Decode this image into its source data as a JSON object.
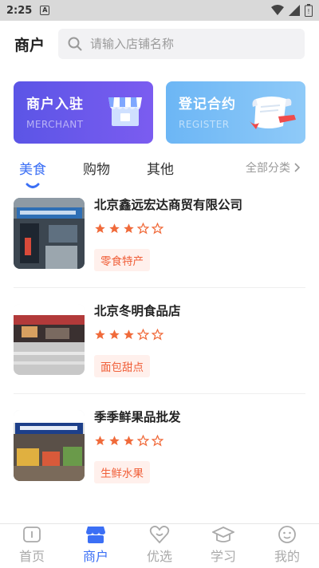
{
  "status_bar": {
    "time": "2:25",
    "notification_badge": "A"
  },
  "header": {
    "title": "商户",
    "search_placeholder": "请输入店铺名称"
  },
  "cards": [
    {
      "title": "商户入驻",
      "subtitle": "MERCHANT",
      "icon": "storefront-icon"
    },
    {
      "title": "登记合约",
      "subtitle": "REGISTER",
      "icon": "scroll-icon"
    }
  ],
  "tabs": {
    "items": [
      "美食",
      "购物",
      "其他"
    ],
    "active_index": 0,
    "all_label": "全部分类"
  },
  "shops": [
    {
      "name": "北京鑫远宏达商贸有限公司",
      "rating": 3,
      "max_rating": 5,
      "tag": "零食特产"
    },
    {
      "name": "北京冬明食品店",
      "rating": 3,
      "max_rating": 5,
      "tag": "面包甜点"
    },
    {
      "name": "季季鲜果品批发",
      "rating": 3,
      "max_rating": 5,
      "tag": "生鲜水果"
    }
  ],
  "tabbar": {
    "items": [
      {
        "label": "首页",
        "icon": "home-icon"
      },
      {
        "label": "商户",
        "icon": "shop-icon"
      },
      {
        "label": "优选",
        "icon": "heart-icon"
      },
      {
        "label": "学习",
        "icon": "graduation-cap-icon"
      },
      {
        "label": "我的",
        "icon": "smiley-icon"
      }
    ],
    "active_index": 1
  },
  "colors": {
    "accent": "#3b6ff5",
    "tag_text": "#f0603a",
    "tag_bg": "#fff0ec",
    "star": "#f06a3a"
  }
}
